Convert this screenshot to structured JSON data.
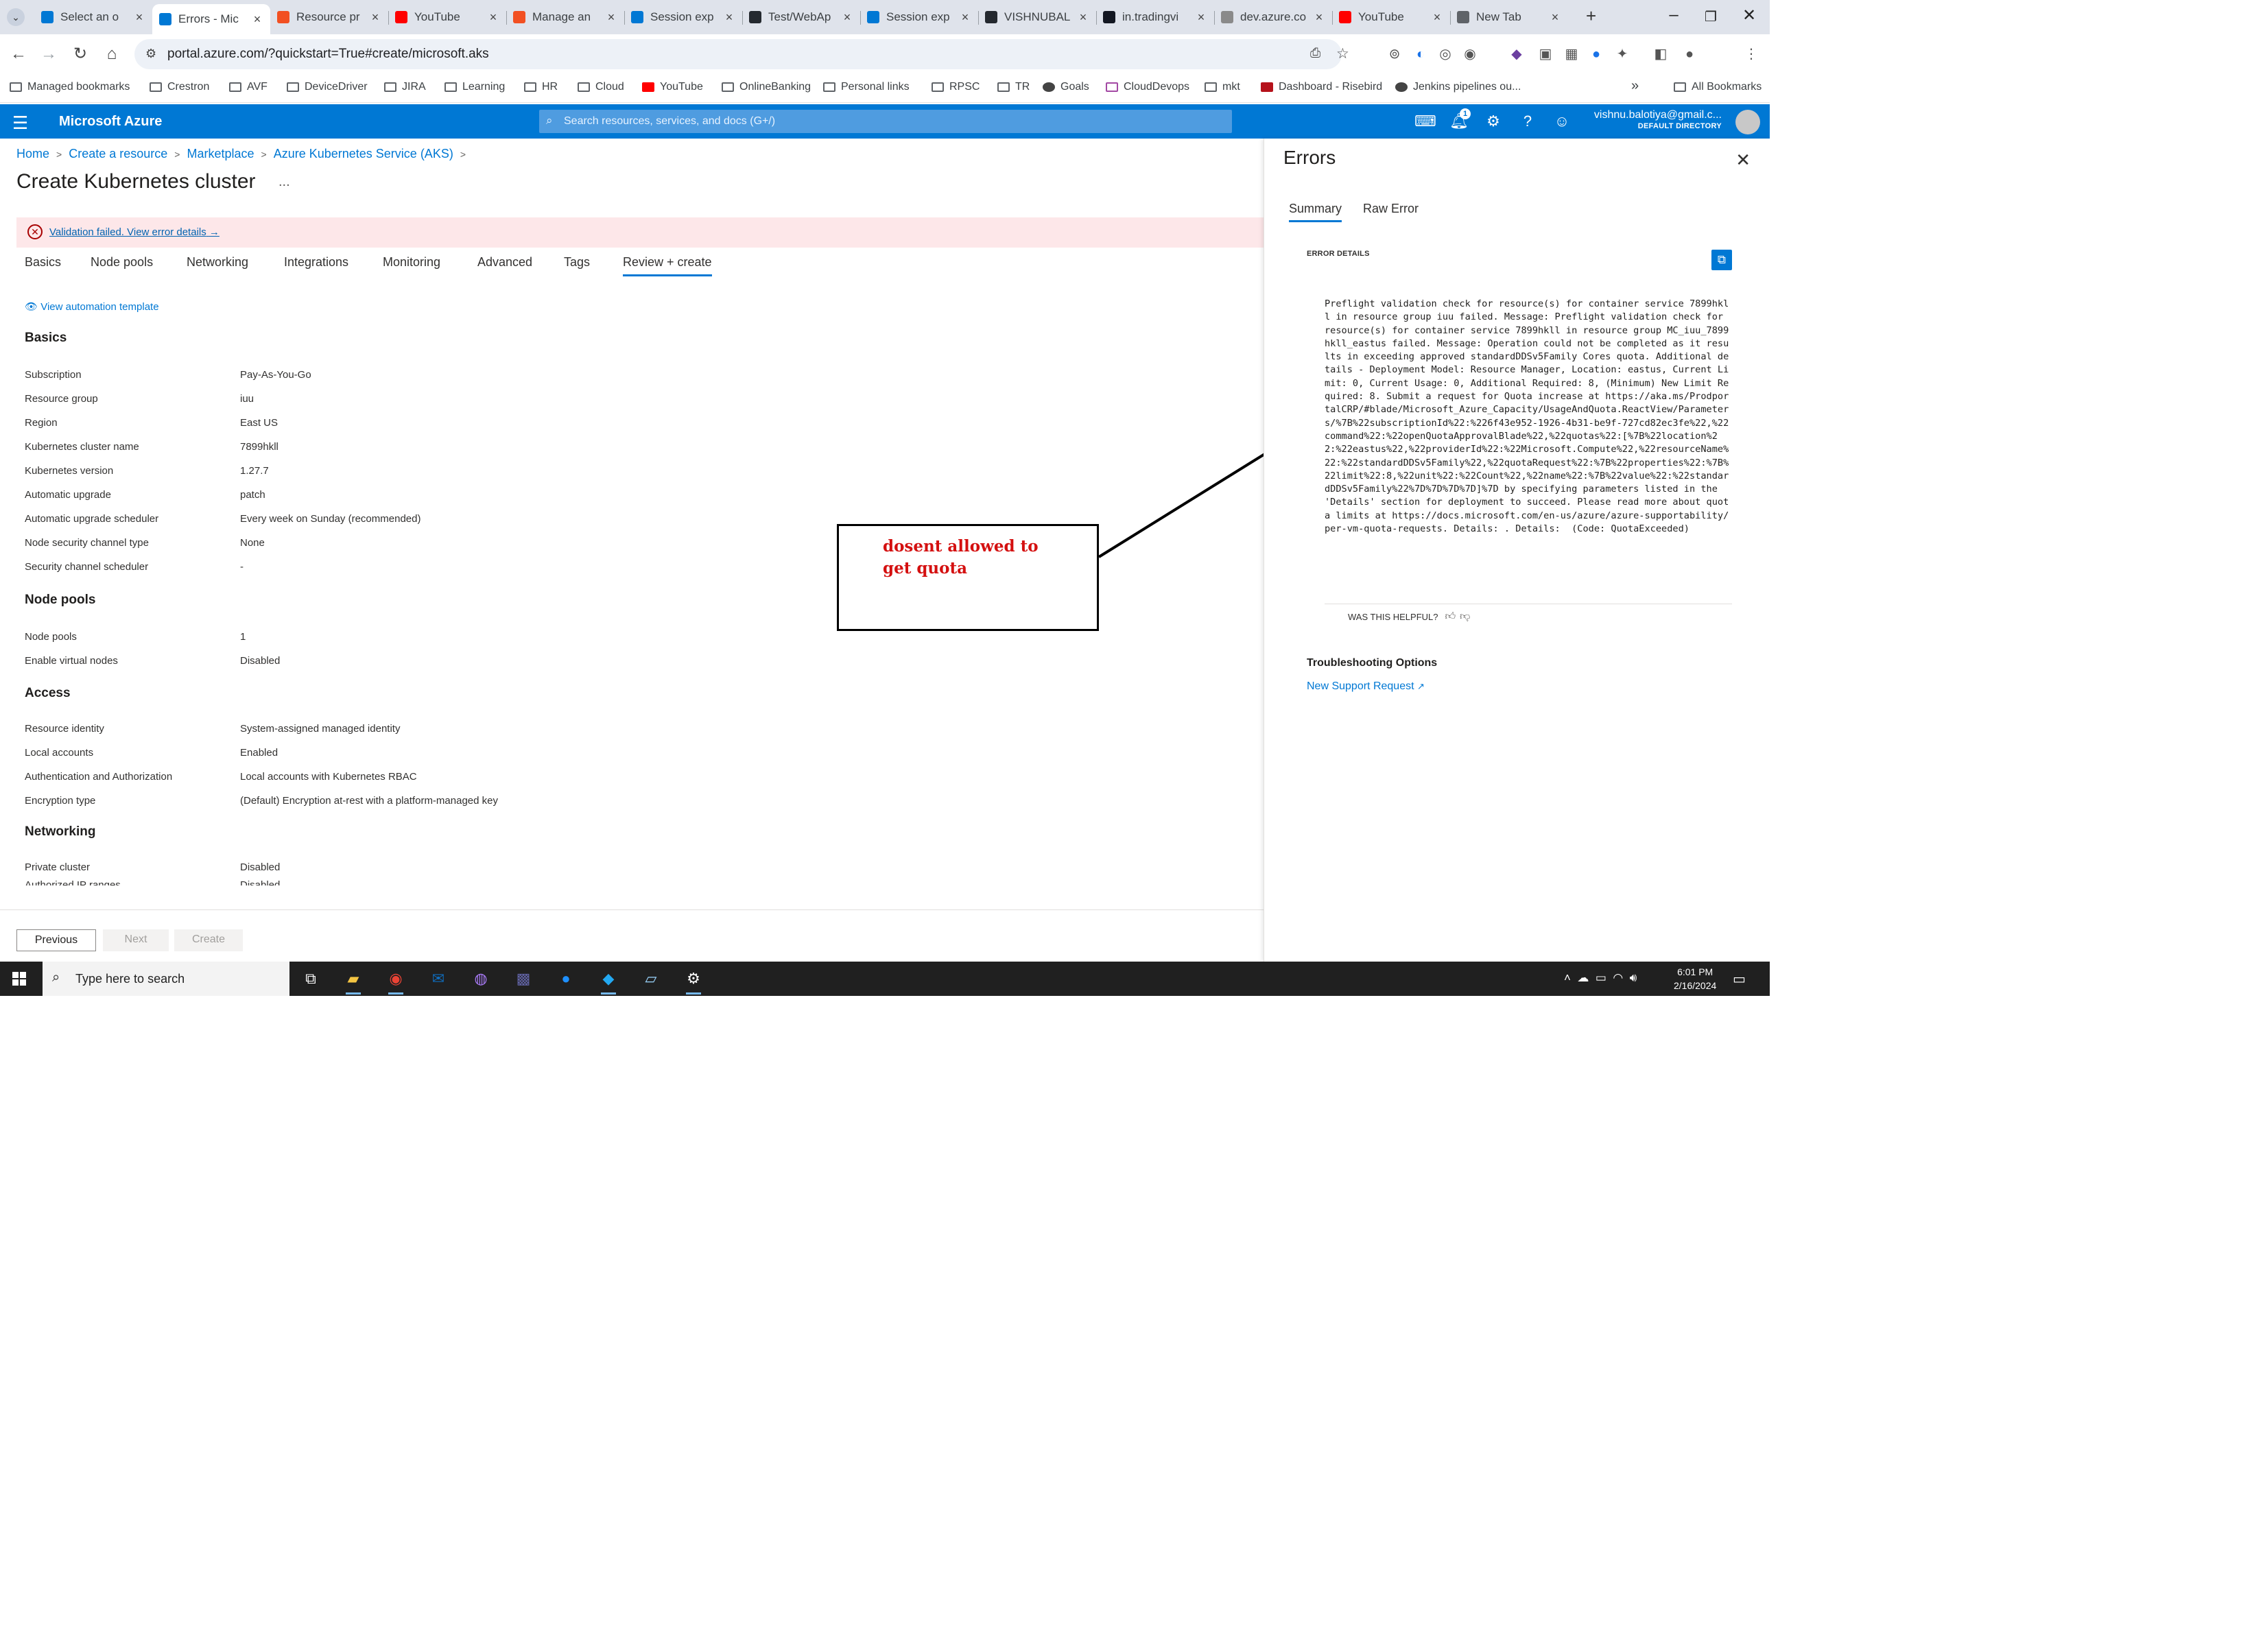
{
  "browser": {
    "tabs": [
      {
        "label": "Select an o",
        "favicon_color": "#0078d4"
      },
      {
        "label": "Errors - Mic",
        "favicon_color": "#0078d4"
      },
      {
        "label": "Resource pr",
        "favicon_color": "#f25022"
      },
      {
        "label": "YouTube",
        "favicon_color": "#ff0000"
      },
      {
        "label": "Manage an",
        "favicon_color": "#f25022"
      },
      {
        "label": "Session exp",
        "favicon_color": "#0078d4"
      },
      {
        "label": "Test/WebAp",
        "favicon_color": "#24292f"
      },
      {
        "label": "Session exp",
        "favicon_color": "#0078d4"
      },
      {
        "label": "VISHNUBAL",
        "favicon_color": "#24292f"
      },
      {
        "label": "in.tradingvi",
        "favicon_color": "#131722"
      },
      {
        "label": "dev.azure.co",
        "favicon_color": "#8a8a8a"
      },
      {
        "label": "YouTube",
        "favicon_color": "#ff0000"
      },
      {
        "label": "New Tab",
        "favicon_color": "#5f6368"
      }
    ],
    "new_tab_symbol": "+",
    "url": "portal.azure.com/?quickstart=True#create/microsoft.aks",
    "bookmarks": [
      "Managed bookmarks",
      "Crestron",
      "AVF",
      "DeviceDriver",
      "JIRA",
      "Learning",
      "HR",
      "Cloud",
      "YouTube",
      "OnlineBanking",
      "Personal links",
      "RPSC",
      "TR",
      "Goals",
      "CloudDevops",
      "mkt",
      "Dashboard - Risebird",
      "Jenkins pipelines ou..."
    ],
    "bookmarks_overflow": "»",
    "all_bookmarks": "All Bookmarks"
  },
  "azure": {
    "brand": "Microsoft Azure",
    "search_placeholder": "Search resources, services, and docs (G+/)",
    "notification_count": "1",
    "user_email": "vishnu.balotiya@gmail.c...",
    "user_directory": "DEFAULT DIRECTORY",
    "accent_color": "#0078d4"
  },
  "main": {
    "breadcrumb": [
      "Home",
      "Create a resource",
      "Marketplace",
      "Azure Kubernetes Service (AKS)"
    ],
    "title": "Create Kubernetes cluster",
    "more": "...",
    "validation_message": "Validation failed. View error details",
    "validation_arrow": "→",
    "tabs": [
      "Basics",
      "Node pools",
      "Networking",
      "Integrations",
      "Monitoring",
      "Advanced",
      "Tags",
      "Review + create"
    ],
    "active_tab": "Review + create",
    "automation_link": "View automation template",
    "sections": {
      "basics": {
        "heading": "Basics",
        "rows": [
          {
            "label": "Subscription",
            "value": "Pay-As-You-Go"
          },
          {
            "label": "Resource group",
            "value": "iuu"
          },
          {
            "label": "Region",
            "value": "East US"
          },
          {
            "label": "Kubernetes cluster name",
            "value": "7899hkll"
          },
          {
            "label": "Kubernetes version",
            "value": "1.27.7"
          },
          {
            "label": "Automatic upgrade",
            "value": "patch"
          },
          {
            "label": "Automatic upgrade scheduler",
            "value": "Every week on Sunday (recommended)"
          },
          {
            "label": "Node security channel type",
            "value": "None"
          },
          {
            "label": "Security channel scheduler",
            "value": "-"
          }
        ]
      },
      "node_pools": {
        "heading": "Node pools",
        "rows": [
          {
            "label": "Node pools",
            "value": "1"
          },
          {
            "label": "Enable virtual nodes",
            "value": "Disabled"
          }
        ]
      },
      "access": {
        "heading": "Access",
        "rows": [
          {
            "label": "Resource identity",
            "value": "System-assigned managed identity"
          },
          {
            "label": "Local accounts",
            "value": "Enabled"
          },
          {
            "label": "Authentication and Authorization",
            "value": "Local accounts with Kubernetes RBAC"
          },
          {
            "label": "Encryption type",
            "value": "(Default) Encryption at-rest with a platform-managed key"
          }
        ]
      },
      "networking": {
        "heading": "Networking",
        "rows": [
          {
            "label": "Private cluster",
            "value": "Disabled"
          }
        ]
      }
    },
    "footer": {
      "previous": "Previous",
      "next": "Next",
      "create": "Create"
    }
  },
  "errors_panel": {
    "title": "Errors",
    "tabs": [
      "Summary",
      "Raw Error"
    ],
    "active_tab": "Summary",
    "details_label": "ERROR DETAILS",
    "message": "Preflight validation check for resource(s) for container service 7899hkll in resource group iuu failed. Message: Preflight validation check for resource(s) for container service 7899hkll in resource group MC_iuu_7899hkll_eastus failed. Message: Operation could not be completed as it results in exceeding approved standardDDSv5Family Cores quota. Additional details - Deployment Model: Resource Manager, Location: eastus, Current Limit: 0, Current Usage: 0, Additional Required: 8, (Minimum) New Limit Required: 8. Submit a request for Quota increase at https://aka.ms/ProdportalCRP/#blade/Microsoft_Azure_Capacity/UsageAndQuota.ReactView/Parameters/%7B%22subscriptionId%22:%226f43e952-1926-4b31-be9f-727cd82ec3fe%22,%22command%22:%22openQuotaApprovalBlade%22,%22quotas%22:[%7B%22location%22:%22eastus%22,%22providerId%22:%22Microsoft.Compute%22,%22resourceName%22:%22standardDDSv5Family%22,%22quotaRequest%22:%7B%22properties%22:%7B%22limit%22:8,%22unit%22:%22Count%22,%22name%22:%7B%22value%22:%22standardDDSv5Family%22%7D%7D%7D%7D]%7D by specifying parameters listed in the 'Details' section for deployment to succeed. Please read more about quota limits at https://docs.microsoft.com/en-us/azure/azure-supportability/per-vm-quota-requests. Details: . Details:  (Code: QuotaExceeded)",
    "helpful_prompt": "WAS THIS HELPFUL?",
    "troubleshooting_title": "Troubleshooting Options",
    "support_link": "New Support Request"
  },
  "annotation": {
    "text_line1": "dosent allowed to",
    "text_line2": "get quota",
    "text_color": "#d41010"
  },
  "taskbar": {
    "search_placeholder": "Type here to search",
    "time": "6:01 PM",
    "date": "2/16/2024"
  }
}
